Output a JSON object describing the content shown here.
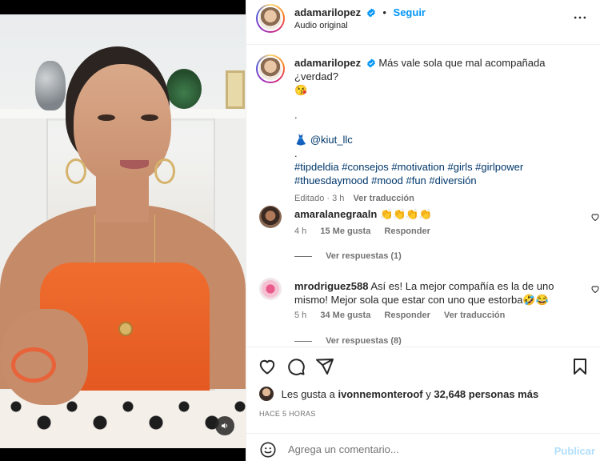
{
  "post": {
    "username": "adamarilopez",
    "follow_label": "Seguir",
    "separator": "•",
    "audio_label": "Audio original"
  },
  "caption": {
    "username": "adamarilopez",
    "text": "Más vale sola que mal acompañada ¿verdad?",
    "emoji_line": "😘",
    "dot_line": ".",
    "mention_emoji": "👗",
    "mention": "@kiut_llc",
    "dot_line_2": ".",
    "tags_line_1": "#tipdeldia #consejos #motivation #girls #girlpower",
    "tags_line_2": "#thuesdaymood #mood #fun #diversión",
    "edited": "Editado · 3 h",
    "translate": "Ver traducción"
  },
  "comments": [
    {
      "username": "amaralanegraaln",
      "text": "👏👏👏👏",
      "time": "4 h",
      "likes": "15 Me gusta",
      "reply": "Responder",
      "view_replies": "Ver respuestas (1)"
    },
    {
      "username": "mrodriguez588",
      "text": "Así es! La mejor compañía es la de uno mismo! Mejor sola que estar con uno que estorba🤣😂",
      "time": "5 h",
      "likes": "34 Me gusta",
      "reply": "Responder",
      "translate": "Ver traducción",
      "view_replies": "Ver respuestas (8)"
    }
  ],
  "likes": {
    "prefix": "Les gusta a",
    "user": "ivonnemonteroof",
    "joiner": "y",
    "count": "32,648 personas más"
  },
  "time_ago": "HACE 5 HORAS",
  "add_comment": {
    "placeholder": "Agrega un comentario...",
    "publish": "Publicar"
  },
  "icons": {
    "verified": "verified-badge-icon",
    "more": "more-options-icon",
    "like": "heart-icon",
    "comment": "comment-icon",
    "share": "share-icon",
    "save": "bookmark-icon",
    "emoji": "emoji-icon",
    "mute": "audio-muted-icon"
  },
  "colors": {
    "link": "#0095f6",
    "hashtag": "#00376b",
    "muted": "#737373",
    "publish_disabled": "#b2dffc"
  }
}
